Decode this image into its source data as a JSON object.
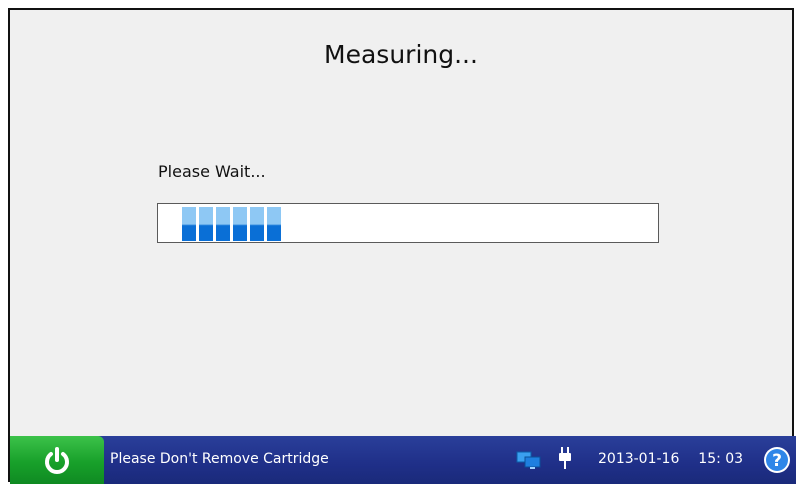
{
  "screen": {
    "title": "Measuring...",
    "wait_label": "Please Wait...",
    "progress": {
      "filled_segments": 6,
      "animated": true
    }
  },
  "statusbar": {
    "power_icon": "power-icon",
    "message": "Please Don't Remove Cartridge",
    "connection_icon": "monitor-connection-icon",
    "power_source_icon": "plug-icon",
    "date": "2013-01-16",
    "time": "15: 03",
    "help_icon": "help-icon"
  },
  "colors": {
    "background": "#f0f0f0",
    "statusbar": "#1f2f88",
    "power_button": "#18a02a",
    "progress_fill": "#0a6fd6",
    "progress_fill_light": "#8ec8f4"
  }
}
